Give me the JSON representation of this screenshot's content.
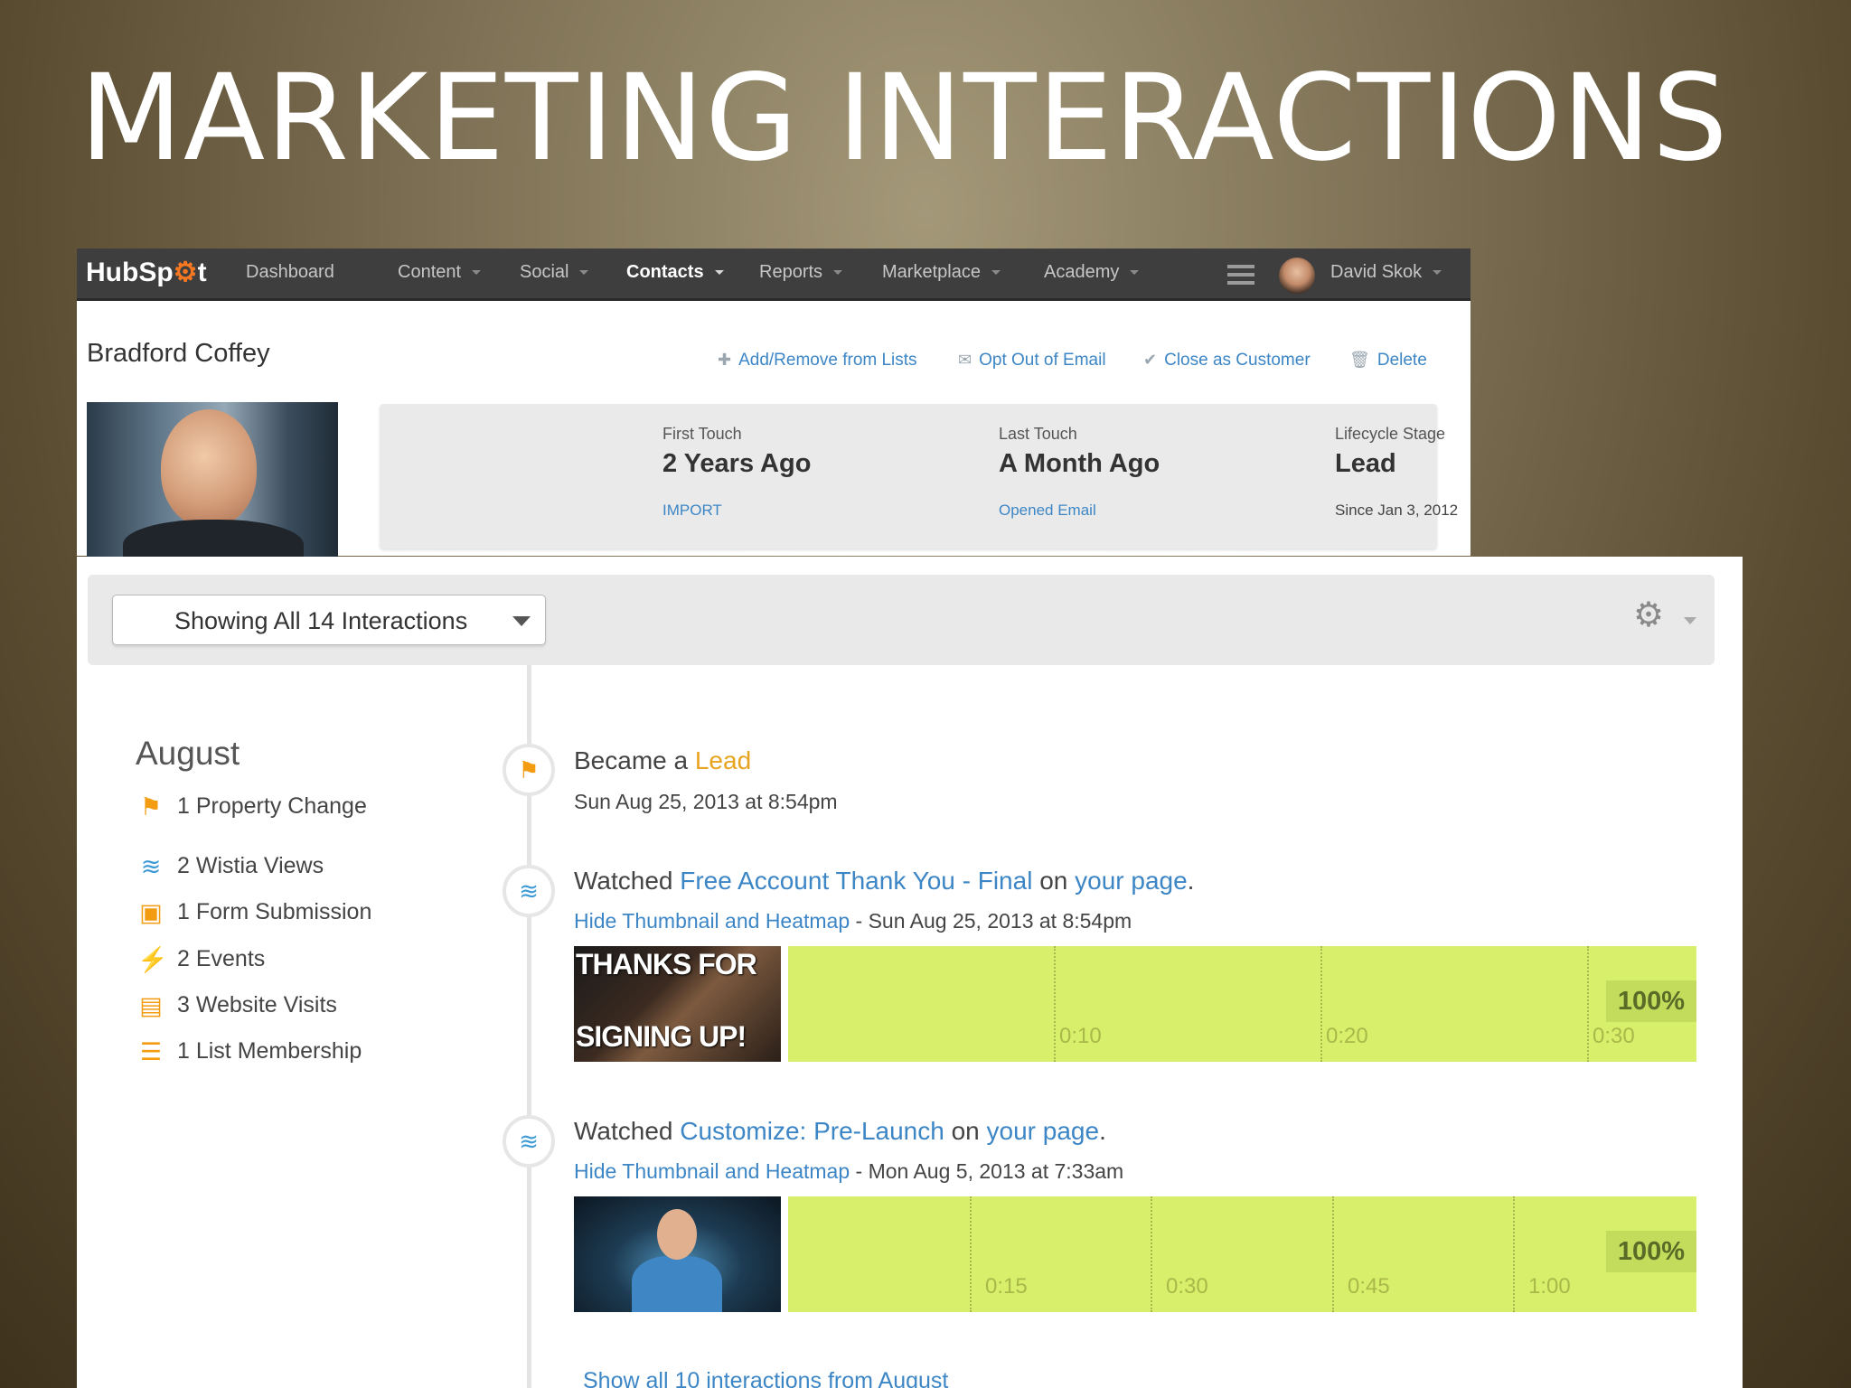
{
  "slide": {
    "title": "MARKETING INTERACTIONS"
  },
  "nav": {
    "logo_a": "HubSp",
    "logo_b": "t",
    "items": [
      {
        "label": "Dashboard"
      },
      {
        "label": "Content"
      },
      {
        "label": "Social"
      },
      {
        "label": "Contacts"
      },
      {
        "label": "Reports"
      },
      {
        "label": "Marketplace"
      },
      {
        "label": "Academy"
      }
    ],
    "active": "Contacts",
    "user": "David Skok"
  },
  "contact": {
    "name": "Bradford Coffey",
    "actions": [
      {
        "label": "Add/Remove from Lists",
        "icon": "plus-icon"
      },
      {
        "label": "Opt Out of Email",
        "icon": "envelope-icon"
      },
      {
        "label": "Close as Customer",
        "icon": "check-icon"
      },
      {
        "label": "Delete",
        "icon": "trash-icon"
      }
    ],
    "touch": [
      {
        "label": "First Touch",
        "value": "2 Years Ago",
        "sub": "IMPORT"
      },
      {
        "label": "Last Touch",
        "value": "A Month Ago",
        "sub": "Opened Email"
      },
      {
        "label": "Lifecycle Stage",
        "value": "Lead",
        "sub": "Since Jan 3, 2012"
      }
    ]
  },
  "timeline": {
    "filter": "Showing All 14 Interactions",
    "month": "August",
    "summary": [
      {
        "text": "1 Property Change",
        "icon": "flag-icon",
        "color": "#f39c12"
      },
      {
        "text": "2 Wistia Views",
        "icon": "wistia-icon",
        "color": "#3d9ad6"
      },
      {
        "text": "1 Form Submission",
        "icon": "form-icon",
        "color": "#f39c12"
      },
      {
        "text": "2 Events",
        "icon": "lightning-icon",
        "color": "#f39c12"
      },
      {
        "text": "3 Website Visits",
        "icon": "browser-icon",
        "color": "#f39c12"
      },
      {
        "text": "1 List Membership",
        "icon": "list-icon",
        "color": "#f39c12"
      }
    ],
    "events": [
      {
        "prefix": "Became a ",
        "highlight": "Lead",
        "sub": "Sun Aug 25, 2013 at 8:54pm"
      },
      {
        "prefix": "Watched ",
        "video": "Free Account Thank You - Final",
        "on": " on ",
        "page": "your page",
        "end": ".",
        "sub_link": "Hide Thumbnail and Heatmap",
        "sub": " - Sun Aug 25, 2013 at 8:54pm",
        "thumb_text": [
          "THANKS FOR",
          "SIGNING UP!"
        ],
        "ticks": [
          "0:10",
          "0:20",
          "0:30"
        ],
        "percent": "100%"
      },
      {
        "prefix": "Watched ",
        "video": "Customize: Pre-Launch",
        "on": " on ",
        "page": "your page",
        "end": ".",
        "sub_link": "Hide Thumbnail and Heatmap",
        "sub": " - Mon Aug 5, 2013 at 7:33am",
        "ticks": [
          "0:15",
          "0:30",
          "0:45",
          "1:00"
        ],
        "percent": "100%"
      }
    ],
    "show_all": "Show all 10 interactions from August"
  },
  "colors": {
    "nav_bg": "#3e3e3e",
    "link": "#3d86c6",
    "accent": "#f57722",
    "heatmap": "#d8ef6c"
  }
}
